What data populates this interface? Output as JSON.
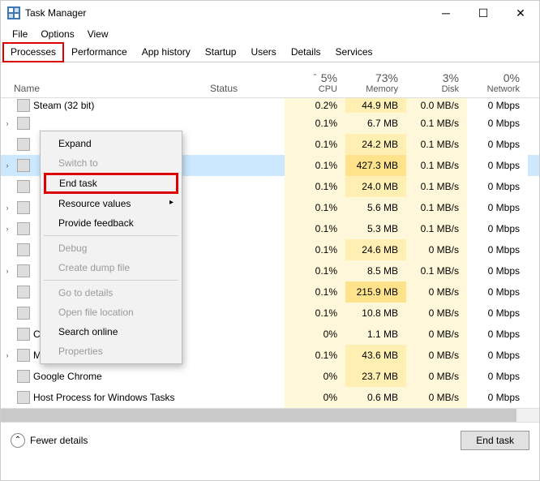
{
  "title": "Task Manager",
  "menu": {
    "file": "File",
    "options": "Options",
    "view": "View"
  },
  "tabs": {
    "processes": "Processes",
    "performance": "Performance",
    "apphistory": "App history",
    "startup": "Startup",
    "users": "Users",
    "details": "Details",
    "services": "Services"
  },
  "columns": {
    "name": "Name",
    "status": "Status",
    "cpu_pct": "5%",
    "cpu": "CPU",
    "mem_pct": "73%",
    "mem": "Memory",
    "disk_pct": "3%",
    "disk": "Disk",
    "net_pct": "0%",
    "net": "Network"
  },
  "rows": [
    {
      "name": "Steam (32 bit)",
      "cpu": "0.2%",
      "mem": "44.9 MB",
      "disk": "0.0 MB/s",
      "net": "0 Mbps",
      "exp": ""
    },
    {
      "name": "",
      "cpu": "0.1%",
      "mem": "6.7 MB",
      "disk": "0.1 MB/s",
      "net": "0 Mbps",
      "exp": "›"
    },
    {
      "name": "",
      "cpu": "0.1%",
      "mem": "24.2 MB",
      "disk": "0.1 MB/s",
      "net": "0 Mbps",
      "exp": ""
    },
    {
      "name": "",
      "cpu": "0.1%",
      "mem": "427.3 MB",
      "disk": "0.1 MB/s",
      "net": "0 Mbps",
      "exp": "›",
      "selected": true
    },
    {
      "name": "",
      "cpu": "0.1%",
      "mem": "24.0 MB",
      "disk": "0.1 MB/s",
      "net": "0 Mbps",
      "exp": ""
    },
    {
      "name": "",
      "cpu": "0.1%",
      "mem": "5.6 MB",
      "disk": "0.1 MB/s",
      "net": "0 Mbps",
      "exp": "›"
    },
    {
      "name": "",
      "cpu": "0.1%",
      "mem": "5.3 MB",
      "disk": "0.1 MB/s",
      "net": "0 Mbps",
      "exp": "›"
    },
    {
      "name": "",
      "cpu": "0.1%",
      "mem": "24.6 MB",
      "disk": "0 MB/s",
      "net": "0 Mbps",
      "exp": ""
    },
    {
      "name": "",
      "cpu": "0.1%",
      "mem": "8.5 MB",
      "disk": "0.1 MB/s",
      "net": "0 Mbps",
      "exp": "›"
    },
    {
      "name": "",
      "cpu": "0.1%",
      "mem": "215.9 MB",
      "disk": "0 MB/s",
      "net": "0 Mbps",
      "exp": ""
    },
    {
      "name": "",
      "cpu": "0.1%",
      "mem": "10.8 MB",
      "disk": "0 MB/s",
      "net": "0 Mbps",
      "exp": ""
    },
    {
      "name": "Client Server Runtime Process",
      "cpu": "0%",
      "mem": "1.1 MB",
      "disk": "0 MB/s",
      "net": "0 Mbps",
      "exp": ""
    },
    {
      "name": "Microsoft Outlook",
      "cpu": "0.1%",
      "mem": "43.6 MB",
      "disk": "0 MB/s",
      "net": "0 Mbps",
      "exp": "›"
    },
    {
      "name": "Google Chrome",
      "cpu": "0%",
      "mem": "23.7 MB",
      "disk": "0 MB/s",
      "net": "0 Mbps",
      "exp": ""
    },
    {
      "name": "Host Process for Windows Tasks",
      "cpu": "0%",
      "mem": "0.6 MB",
      "disk": "0 MB/s",
      "net": "0 Mbps",
      "exp": ""
    }
  ],
  "context_menu": {
    "expand": "Expand",
    "switch_to": "Switch to",
    "end_task": "End task",
    "resource_values": "Resource values",
    "provide_feedback": "Provide feedback",
    "debug": "Debug",
    "create_dump": "Create dump file",
    "goto_details": "Go to details",
    "open_file_loc": "Open file location",
    "search_online": "Search online",
    "properties": "Properties"
  },
  "footer": {
    "fewer": "Fewer details",
    "end_task": "End task"
  }
}
